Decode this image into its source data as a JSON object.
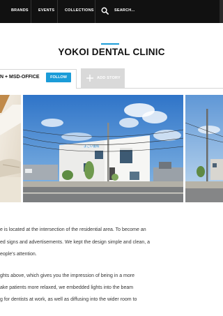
{
  "nav": {
    "items": [
      "BRANDS",
      "EVENTS",
      "COLLECTIONS"
    ],
    "search_placeholder": "SEARCH..."
  },
  "page": {
    "title": "YOKOI DENTAL CLINIC",
    "accent_color": "#1b9cd8"
  },
  "tabs": {
    "author": "N + MSD-OFFICE",
    "follow_label": "FOLLOW",
    "add_story_label": "ADD STORY"
  },
  "icons": {
    "search": "search-icon",
    "add": "plus-icon"
  },
  "gallery": {
    "sign_text": "よこい歯科"
  },
  "article": {
    "lines": [
      "e is located at the intersection of the residential area. To become an",
      "ed signs and advertisements. We kept the design simple and clean, a",
      "eople's attention.",
      "",
      "ghts above, which gives you the impression of being in a more",
      "ake patients more relaxed, we embedded lights into the beam",
      "g for dentists at work, as well as diffusing into the wider room to"
    ]
  }
}
